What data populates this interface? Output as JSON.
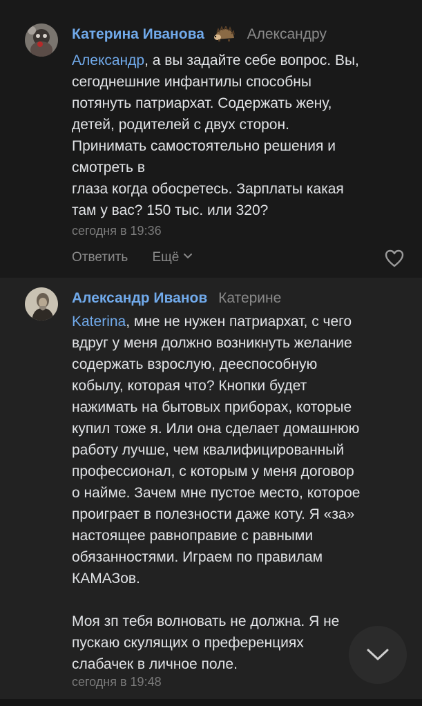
{
  "comments": [
    {
      "author": "Катерина Иванова",
      "reply_to": "Александру",
      "mention": "Александр",
      "text_lines": [
        ", а вы задайте себе вопрос. Вы,",
        "сегоднешние инфантилы способны",
        "потянуть патриархат. Содержать жену,",
        "детей, родителей с двух сторон.",
        "Принимать самостоятельно решения и",
        "смотреть в",
        "глаза когда обосретесь. Зарплаты какая",
        "там у вас? 150 тыс. или 320?"
      ],
      "time": "сегодня в 19:36",
      "reply_label": "Ответить",
      "more_label": "Ещё"
    },
    {
      "author": "Александр Иванов",
      "reply_to": "Катерине",
      "mention": "Katerina",
      "text_lines": [
        ", мне не нужен патриархат, с чего",
        "вдруг у меня должно возникнуть желание",
        "содержать взрослую, дееспособную",
        "кобылу, которая что? Кнопки будет",
        "нажимать на бытовых приборах, которые",
        "купил тоже я. Или она сделает домашнюю",
        "работу лучше, чем квалифицированный",
        "профессионал, с которым у меня договор",
        "о найме. Зачем мне пустое место, которое",
        "проиграет в полезности даже коту. Я «за»",
        "настоящее равноправие с равными",
        "обязанностями. Играем по правилам",
        "КАМАЗов.",
        "",
        "Моя зп тебя волновать не должна. Я не",
        "пускаю скулящих о преференциях",
        "слабачек в личное поле."
      ],
      "time": "сегодня в 19:48"
    }
  ],
  "icons": {
    "like": "heart-icon",
    "more_chevron": "chevron-down-icon",
    "scroll_down": "chevron-down-icon",
    "author_badge": "hedgehog-icon"
  },
  "colors": {
    "link": "#71aaeb",
    "text": "#e1e3e6",
    "muted": "#7a7a7a"
  }
}
